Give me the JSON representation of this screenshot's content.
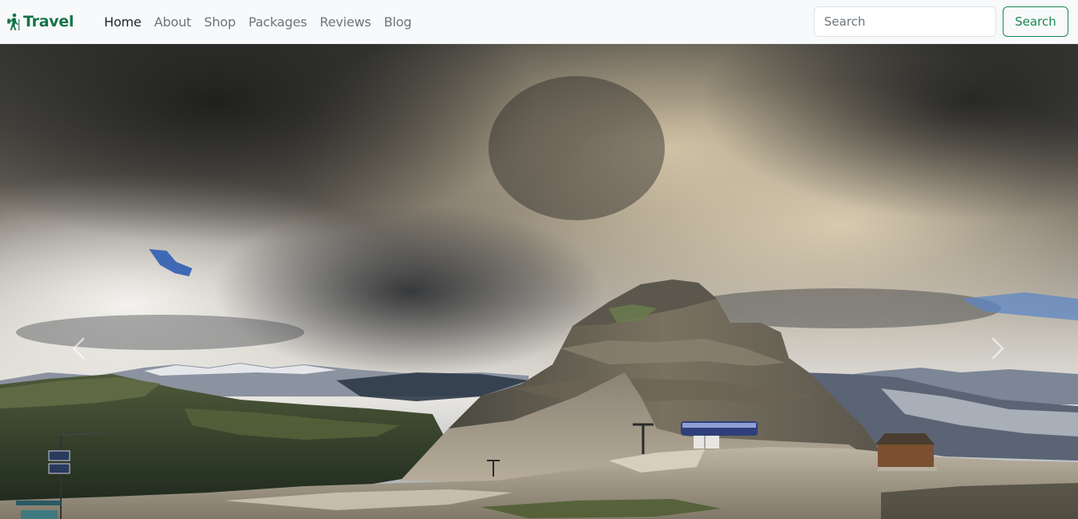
{
  "navbar": {
    "brand": {
      "text": "Travel",
      "icon": "hiking-icon",
      "color": "#157347"
    },
    "links": [
      {
        "label": "Home",
        "active": true
      },
      {
        "label": "About",
        "active": false
      },
      {
        "label": "Shop",
        "active": false
      },
      {
        "label": "Packages",
        "active": false
      },
      {
        "label": "Reviews",
        "active": false
      },
      {
        "label": "Blog",
        "active": false
      }
    ],
    "search": {
      "placeholder": "Search",
      "value": "",
      "button_label": "Search",
      "button_color": "#198754"
    }
  },
  "hero": {
    "image_subject": "mountain-peak-under-storm-clouds",
    "controls": {
      "prev_icon": "chevron-left-icon",
      "next_icon": "chevron-right-icon"
    }
  }
}
